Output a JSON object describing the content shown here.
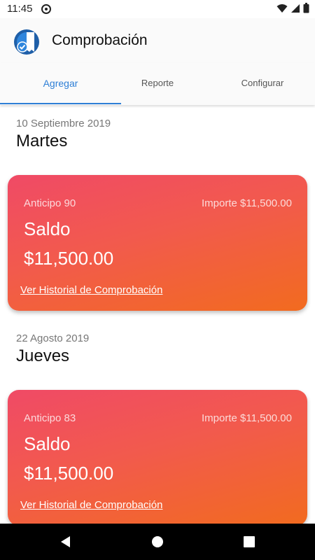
{
  "status_bar": {
    "time": "11:45",
    "icons": [
      "at-sign-icon",
      "wifi-icon",
      "cellular-signal-icon",
      "battery-icon"
    ]
  },
  "header": {
    "title": "Comprobación",
    "logo_icon": "receipt-check-logo-icon"
  },
  "tabs": [
    {
      "label": "Agregar",
      "active": true
    },
    {
      "label": "Reporte",
      "active": false
    },
    {
      "label": "Configurar",
      "active": false
    }
  ],
  "entries": [
    {
      "date": "10 Septiembre 2019",
      "day": "Martes",
      "anticipo": "Anticipo 90",
      "importe": "Importe $11,500.00",
      "saldo_label": "Saldo",
      "saldo_value": "$11,500.00",
      "link": "Ver Historial de Comprobación"
    },
    {
      "date": "22 Agosto 2019",
      "day": "Jueves",
      "anticipo": "Anticipo 83",
      "importe": "Importe $11,500.00",
      "saldo_label": "Saldo",
      "saldo_value": "$11,500.00",
      "link": "Ver Historial de Comprobación"
    }
  ],
  "nav": {
    "icons": [
      "back-icon",
      "home-icon",
      "recents-icon"
    ]
  },
  "colors": {
    "accent": "#2e7fd6",
    "card_gradient_start": "#f04a66",
    "card_gradient_end": "#f26b1f",
    "nav_background": "#000000"
  }
}
